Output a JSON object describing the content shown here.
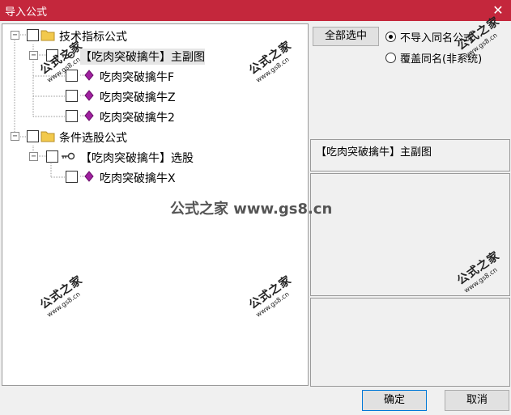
{
  "window": {
    "title": "导入公式",
    "close_glyph": "✕"
  },
  "tree": [
    {
      "label": "技术指标公式",
      "expander": "−",
      "type": "folder"
    },
    {
      "label": "【吃肉突破擒牛】主副图",
      "expander": "−",
      "type": "key",
      "selected": true
    },
    {
      "label": "吃肉突破擒牛F",
      "type": "gem"
    },
    {
      "label": "吃肉突破擒牛Z",
      "type": "gem"
    },
    {
      "label": "吃肉突破擒牛2",
      "type": "gem"
    },
    {
      "label": "条件选股公式",
      "expander": "−",
      "type": "folder"
    },
    {
      "label": "【吃肉突破擒牛】选股",
      "expander": "−",
      "type": "key"
    },
    {
      "label": "吃肉突破擒牛X",
      "type": "gem"
    }
  ],
  "right": {
    "select_all_label": "全部选中",
    "radio_options": [
      {
        "label": "不导入同名公式",
        "checked": true
      },
      {
        "label": "覆盖同名(非系统)",
        "checked": false
      }
    ],
    "info_title": "【吃肉突破擒牛】主副图"
  },
  "footer": {
    "ok_label": "确定",
    "cancel_label": "取消"
  },
  "watermark": {
    "brand": "公式之家",
    "url": "www.gs8.cn",
    "center": "公式之家 www.gs8.cn"
  },
  "colors": {
    "titlebar": "#c4273c",
    "folder": "#f2c94c",
    "gem": "#a020a0"
  }
}
